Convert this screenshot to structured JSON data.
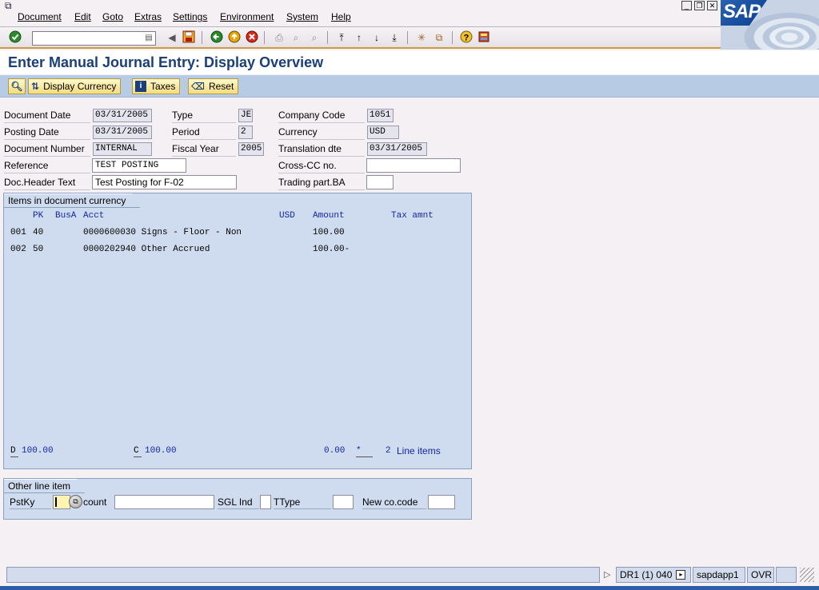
{
  "menu": {
    "items": [
      "Document",
      "Edit",
      "Goto",
      "Extras",
      "Settings",
      "Environment",
      "System",
      "Help"
    ]
  },
  "logo": {
    "text": "SAP"
  },
  "command_field": {
    "value": ""
  },
  "title": "Enter Manual Journal Entry: Display Overview",
  "app_toolbar": {
    "display_currency": "Display Currency",
    "taxes": "Taxes",
    "reset": "Reset"
  },
  "header": {
    "document_date": {
      "label": "Document Date",
      "value": "03/31/2005"
    },
    "posting_date": {
      "label": "Posting Date",
      "value": "03/31/2005"
    },
    "document_number": {
      "label": "Document Number",
      "value": "INTERNAL"
    },
    "reference": {
      "label": "Reference",
      "value": "TEST POSTING"
    },
    "doc_header_text": {
      "label": "Doc.Header Text",
      "value": "Test Posting for F-02"
    },
    "type": {
      "label": "Type",
      "value": "JE"
    },
    "period": {
      "label": "Period",
      "value": "2"
    },
    "fiscal_year": {
      "label": "Fiscal Year",
      "value": "2005"
    },
    "company_code": {
      "label": "Company Code",
      "value": "1051"
    },
    "currency": {
      "label": "Currency",
      "value": "USD"
    },
    "translation_date": {
      "label": "Translation dte",
      "value": "03/31/2005"
    },
    "cross_cc_no": {
      "label": "Cross-CC no.",
      "value": ""
    },
    "trading_part_ba": {
      "label": "Trading part.BA",
      "value": ""
    }
  },
  "items_group": {
    "title": "Items in document currency",
    "columns": {
      "pk": "PK",
      "busa": "BusA",
      "acct": "Acct",
      "usd": "USD",
      "amount": "Amount",
      "tax": "Tax amnt"
    },
    "rows": [
      {
        "item": "001",
        "pk": "40",
        "acct": "0000600030 Signs - Floor - Non",
        "amount": "100.00"
      },
      {
        "item": "002",
        "pk": "50",
        "acct": "0000202940 Other Accrued",
        "amount": "100.00-"
      }
    ],
    "totals": {
      "debit_label": "D",
      "debit": "100.00",
      "credit_label": "C",
      "credit": "100.00",
      "balance": "0.00",
      "balance_flag": "*",
      "line_count": "2",
      "line_items_label": "Line items"
    }
  },
  "other_line_item": {
    "title": "Other line item",
    "pstky_label": "PstKy",
    "account_label": "count",
    "sgl_label": "SGL Ind",
    "ttype_label": "TType",
    "new_cocode_label": "New co.code",
    "pstky_value": "",
    "account_value": ""
  },
  "status": {
    "system": "DR1 (1) 040",
    "server": "sapdapp1",
    "mode": "OVR"
  },
  "colors": {
    "title": "#1a3f7a",
    "toolbar_accent": "#d19a3c",
    "group_bg": "#cfdbee",
    "column_header": "#1426a6"
  }
}
